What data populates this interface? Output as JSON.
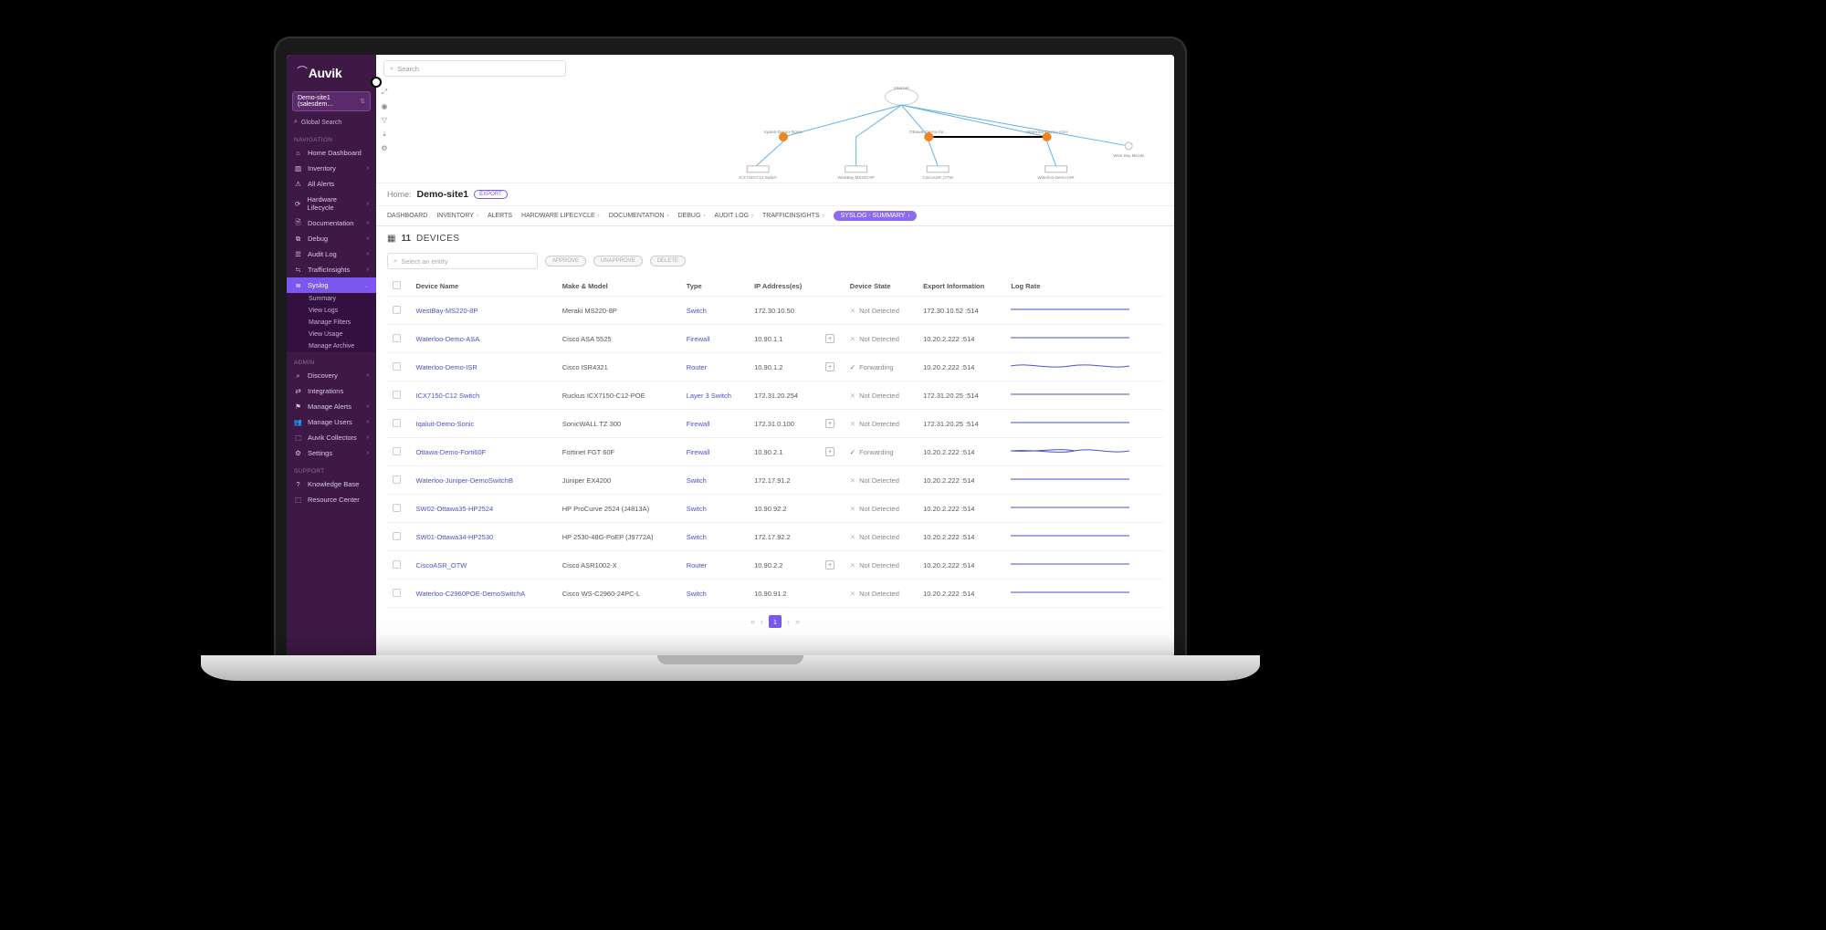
{
  "brand": "Auvik",
  "site_selector": "Demo-site1 (salesdem…",
  "global_search_label": "Global Search",
  "sidebar": {
    "section_nav": "NAVIGATION",
    "section_admin": "ADMIN",
    "section_support": "SUPPORT",
    "items_nav": [
      {
        "label": "Home Dashboard",
        "chev": false
      },
      {
        "label": "Inventory",
        "chev": true
      },
      {
        "label": "All Alerts",
        "chev": false
      },
      {
        "label": "Hardware Lifecycle",
        "chev": true
      },
      {
        "label": "Documentation",
        "chev": true
      },
      {
        "label": "Debug",
        "chev": true
      },
      {
        "label": "Audit Log",
        "chev": true
      },
      {
        "label": "TrafficInsights",
        "chev": true
      }
    ],
    "syslog_label": "Syslog",
    "syslog_sub": [
      "Summary",
      "View Logs",
      "Manage Filters",
      "View Usage",
      "Manage Archive"
    ],
    "items_admin": [
      {
        "label": "Discovery",
        "chev": true
      },
      {
        "label": "Integrations",
        "chev": false
      },
      {
        "label": "Manage Alerts",
        "chev": true
      },
      {
        "label": "Manage Users",
        "chev": true
      },
      {
        "label": "Auvik Collectors",
        "chev": true
      },
      {
        "label": "Settings",
        "chev": true
      }
    ],
    "items_support": [
      {
        "label": "Knowledge Base",
        "chev": false
      },
      {
        "label": "Resource Center",
        "chev": false
      }
    ]
  },
  "top_search_placeholder": "Search",
  "topology": {
    "root": "Internet",
    "nodes": [
      {
        "label": "Iqaluit-Demo-Sonic",
        "leaf": "ICX7150-C12 Switch"
      },
      {
        "label": "",
        "leaf": "WestBay-MS220-8P"
      },
      {
        "label": "Ottawa-Demo-for…",
        "leaf": "CiscoASR_OTW"
      },
      {
        "label": "Waterloo-Demo-ASA",
        "leaf": "Waterloo-Demo-ISR"
      },
      {
        "label": "",
        "leaf": "West Bay Meraki"
      }
    ]
  },
  "breadcrumb_pre": "Home:",
  "breadcrumb_title": "Demo-site1",
  "export_label": "EXPORT",
  "tabs": [
    {
      "label": "DASHBOARD",
      "chev": false
    },
    {
      "label": "INVENTORY",
      "chev": true
    },
    {
      "label": "ALERTS",
      "chev": false
    },
    {
      "label": "HARDWARE LIFECYCLE",
      "chev": true
    },
    {
      "label": "DOCUMENTATION",
      "chev": true
    },
    {
      "label": "DEBUG",
      "chev": true
    },
    {
      "label": "AUDIT LOG",
      "chev": true
    },
    {
      "label": "TRAFFICINSIGHTS",
      "chev": true
    }
  ],
  "tab_active": "SYSLOG - SUMMARY",
  "devices_count": "11",
  "devices_label": "DEVICES",
  "entity_placeholder": "Select an entity",
  "btn_approve": "APPROVE",
  "btn_unapprove": "UNAPPROVE",
  "btn_delete": "DELETE",
  "columns": [
    "Device Name",
    "Make & Model",
    "Type",
    "IP Address(es)",
    "",
    "Device State",
    "Export Information",
    "Log Rate"
  ],
  "rows": [
    {
      "name": "WestBay-MS220-8P",
      "make": "Meraki MS220-8P",
      "type": "Switch",
      "ip": "172.30.10.50",
      "plus": false,
      "state": "Not Detected",
      "stateIcon": "x",
      "export": "172.30.10.52 :514"
    },
    {
      "name": "Waterloo-Demo-ASA",
      "make": "Cisco ASA 5525",
      "type": "Firewall",
      "ip": "10.90.1.1",
      "plus": true,
      "state": "Not Detected",
      "stateIcon": "x",
      "export": "10.20.2.222 :514"
    },
    {
      "name": "Waterloo-Demo-ISR",
      "make": "Cisco ISR4321",
      "type": "Router",
      "ip": "10.90.1.2",
      "plus": true,
      "state": "Forwarding",
      "stateIcon": "ck",
      "export": "10.20.2.222 :514"
    },
    {
      "name": "ICX7150-C12 Switch",
      "make": "Ruckus ICX7150-C12-POE",
      "type": "Layer 3 Switch",
      "ip": "172.31.20.254",
      "plus": false,
      "state": "Not Detected",
      "stateIcon": "x",
      "export": "172.31.20.25 :514"
    },
    {
      "name": "Iqaluit-Demo-Sonic",
      "make": "SonicWALL TZ 300",
      "type": "Firewall",
      "ip": "172.31.0.100",
      "plus": true,
      "state": "Not Detected",
      "stateIcon": "x",
      "export": "172.31.20.25 :514"
    },
    {
      "name": "Ottawa-Demo-Forti60F",
      "make": "Fortinet FGT 60F",
      "type": "Firewall",
      "ip": "10.90.2.1",
      "plus": true,
      "state": "Forwarding",
      "stateIcon": "ck",
      "export": "10.20.2.222 :514"
    },
    {
      "name": "Waterloo-Juniper-DemoSwitchB",
      "make": "Juniper EX4200",
      "type": "Switch",
      "ip": "172.17.91.2",
      "plus": false,
      "state": "Not Detected",
      "stateIcon": "x",
      "export": "10.20.2.222 :514"
    },
    {
      "name": "SW02-Ottawa35-HP2524",
      "make": "HP ProCurve 2524 (J4813A)",
      "type": "Switch",
      "ip": "10.90.92.2",
      "plus": false,
      "state": "Not Detected",
      "stateIcon": "x",
      "export": "10.20.2.222 :514"
    },
    {
      "name": "SW01-Ottawa34-HP2530",
      "make": "HP 2530-48G-PoEP (J9772A)",
      "type": "Switch",
      "ip": "172.17.92.2",
      "plus": false,
      "state": "Not Detected",
      "stateIcon": "x",
      "export": "10.20.2.222 :514"
    },
    {
      "name": "CiscoASR_OTW",
      "make": "Cisco ASR1002-X",
      "type": "Router",
      "ip": "10.90.2.2",
      "plus": true,
      "state": "Not Detected",
      "stateIcon": "x",
      "export": "10.20.2.222 :514"
    },
    {
      "name": "Waterloo-C2960POE-DemoSwitchA",
      "make": "Cisco WS-C2960-24PC-L",
      "type": "Switch",
      "ip": "10.90.91.2",
      "plus": false,
      "state": "Not Detected",
      "stateIcon": "x",
      "export": "10.20.2.222 :514"
    }
  ],
  "page_current": "1",
  "colors": {
    "brand": "#7b57f0",
    "sidebar": "#3e1946",
    "link": "#4a52c9"
  }
}
